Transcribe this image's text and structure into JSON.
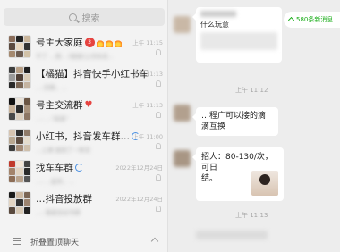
{
  "search": {
    "placeholder": "搜索"
  },
  "chats": [
    {
      "name": "号主大家庭",
      "badge": "3",
      "time": "上午 11:15",
      "sub": "不了 …用… [链接]上月份总…"
    },
    {
      "name": "【橘猫】抖音快手小红书车",
      "time": "上午 11:13",
      "sub": "…:无聊，…"
    },
    {
      "name": "号主交流群",
      "time": "上午 11:13",
      "sub": "…: …\"局易\""
    },
    {
      "name": "小红书，抖音发车群…",
      "time": "上午 11:00",
      "sub": "…上课 接到了一单活"
    },
    {
      "name": "找车车群",
      "time": "2022年12月24日",
      "sub": "…: …起车，…"
    },
    {
      "name": "…抖音投放群",
      "time": "2022年12月24日",
      "sub": "…: 我是创业号群"
    }
  ],
  "fold": {
    "label": "折叠置顶聊天"
  },
  "conversation": {
    "new_messages": "580条新消息",
    "msg1_text": "什么玩意",
    "time1": "上午 11:12",
    "msg2_text": "…程广可以接的滴滴互换",
    "msg3_line1": "招人：80-130/次，可日",
    "msg3_line2": "结。",
    "time2": "上午 11:13"
  },
  "colors": {
    "accent": "#1aad19",
    "badge": "#e64340"
  }
}
